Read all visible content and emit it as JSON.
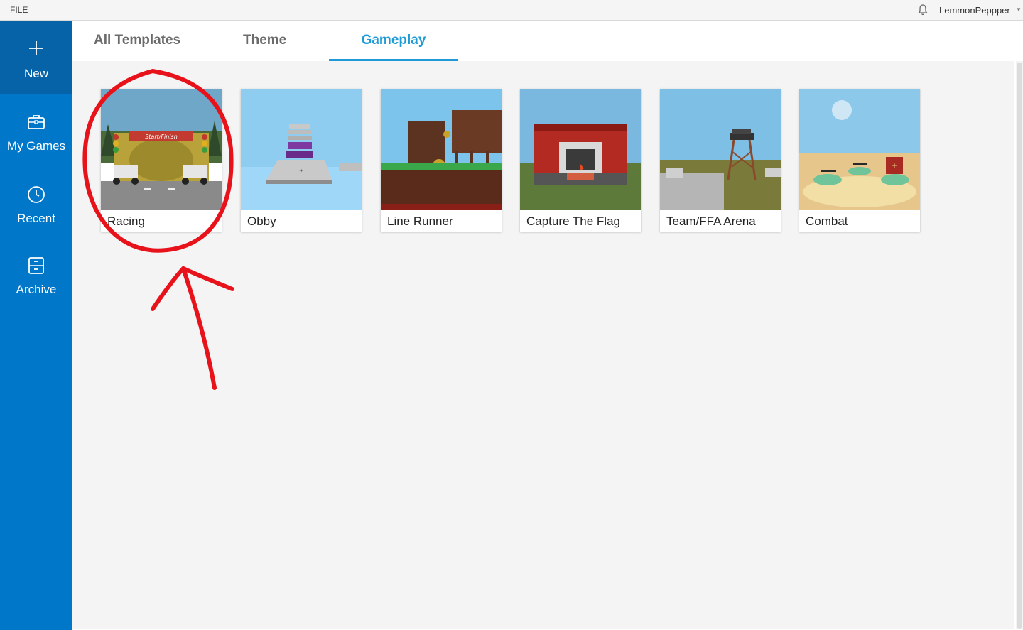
{
  "menu": {
    "file": "FILE"
  },
  "account": {
    "username": "LemmonPeppper",
    "bell_icon": "bell-icon",
    "caret_icon": "caret-down-icon"
  },
  "sidebar": {
    "items": [
      {
        "label": "New",
        "icon": "plus-icon",
        "active": true
      },
      {
        "label": "My Games",
        "icon": "briefcase-icon",
        "active": false
      },
      {
        "label": "Recent",
        "icon": "clock-icon",
        "active": false
      },
      {
        "label": "Archive",
        "icon": "archive-box-icon",
        "active": false
      }
    ]
  },
  "tabs": [
    {
      "label": "All Templates",
      "active": false
    },
    {
      "label": "Theme",
      "active": false
    },
    {
      "label": "Gameplay",
      "active": true
    }
  ],
  "templates": [
    {
      "title": "Racing"
    },
    {
      "title": "Obby"
    },
    {
      "title": "Line Runner"
    },
    {
      "title": "Capture The Flag"
    },
    {
      "title": "Team/FFA Arena"
    },
    {
      "title": "Combat"
    }
  ],
  "racing_banner": "Start/Finish",
  "colors": {
    "sidebar": "#0077c9",
    "sidebar_active": "#0663a8",
    "tab_active": "#1e9bd7",
    "annotation": "#e8121b"
  }
}
